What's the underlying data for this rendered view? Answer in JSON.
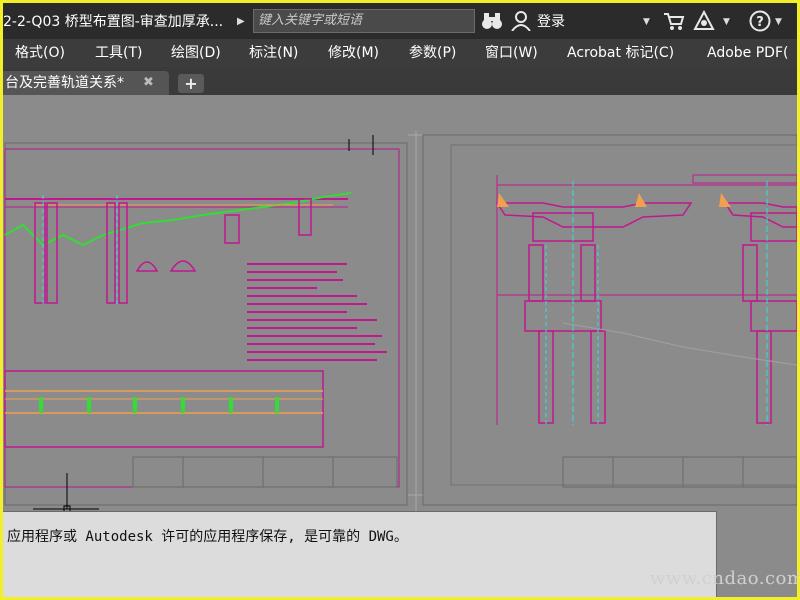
{
  "titlebar": {
    "document_title": "2-2-Q03  桥型布置图-审查加厚承...",
    "search_placeholder": "键入关键字或短语",
    "login_label": "登录"
  },
  "menu": [
    {
      "label": "格式(O)"
    },
    {
      "label": "工具(T)"
    },
    {
      "label": "绘图(D)"
    },
    {
      "label": "标注(N)"
    },
    {
      "label": "修改(M)"
    },
    {
      "label": "参数(P)"
    },
    {
      "label": "窗口(W)"
    },
    {
      "label": "Acrobat 标记(C)"
    },
    {
      "label": "Adobe PDF("
    }
  ],
  "tabs": {
    "active_tab_label": "台及完善轨道关系*",
    "close_glyph": "✖",
    "new_tab_glyph": "+"
  },
  "command_line": {
    "text": "应用程序或 Autodesk 许可的应用程序保存, 是可靠的 DWG。"
  },
  "watermark": "www.cndao.com",
  "colors": {
    "window_border": "#f2ef2a",
    "titlebar": "#2b2b2b",
    "menubar": "#3c3c3c",
    "canvas": "#8b8b8b",
    "drawing_magenta": "#c0188e",
    "drawing_green": "#33dd33",
    "drawing_orange": "#f0a050",
    "drawing_cyan": "#33dddd"
  },
  "icons": {
    "binoculars": "binoculars-icon",
    "user": "user-icon",
    "cart": "cart-icon",
    "autodesk": "autodesk-a360-icon",
    "help": "help-icon",
    "close": "close-icon",
    "expand": "expand-arrow-icon"
  }
}
